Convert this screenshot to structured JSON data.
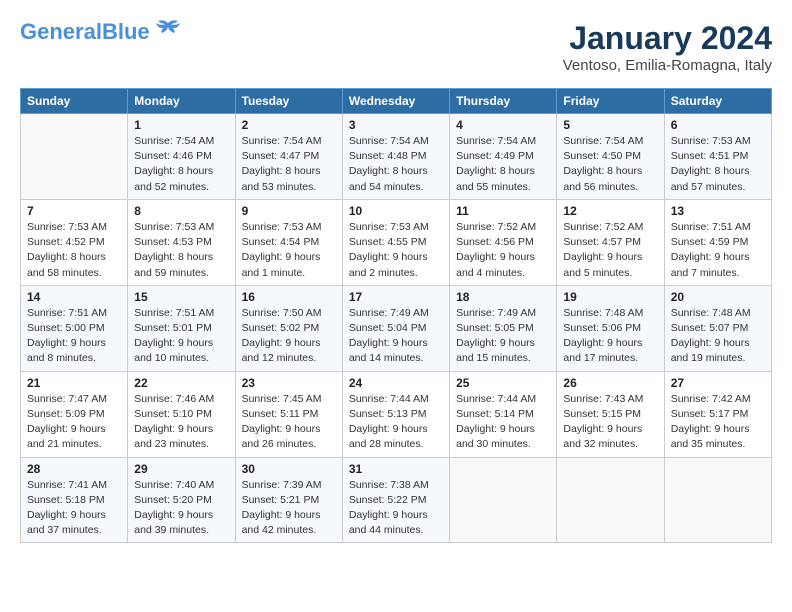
{
  "header": {
    "logo_line1": "General",
    "logo_line2": "Blue",
    "title": "January 2024",
    "subtitle": "Ventoso, Emilia-Romagna, Italy"
  },
  "weekdays": [
    "Sunday",
    "Monday",
    "Tuesday",
    "Wednesday",
    "Thursday",
    "Friday",
    "Saturday"
  ],
  "weeks": [
    [
      {
        "num": "",
        "detail": ""
      },
      {
        "num": "1",
        "detail": "Sunrise: 7:54 AM\nSunset: 4:46 PM\nDaylight: 8 hours\nand 52 minutes."
      },
      {
        "num": "2",
        "detail": "Sunrise: 7:54 AM\nSunset: 4:47 PM\nDaylight: 8 hours\nand 53 minutes."
      },
      {
        "num": "3",
        "detail": "Sunrise: 7:54 AM\nSunset: 4:48 PM\nDaylight: 8 hours\nand 54 minutes."
      },
      {
        "num": "4",
        "detail": "Sunrise: 7:54 AM\nSunset: 4:49 PM\nDaylight: 8 hours\nand 55 minutes."
      },
      {
        "num": "5",
        "detail": "Sunrise: 7:54 AM\nSunset: 4:50 PM\nDaylight: 8 hours\nand 56 minutes."
      },
      {
        "num": "6",
        "detail": "Sunrise: 7:53 AM\nSunset: 4:51 PM\nDaylight: 8 hours\nand 57 minutes."
      }
    ],
    [
      {
        "num": "7",
        "detail": "Sunrise: 7:53 AM\nSunset: 4:52 PM\nDaylight: 8 hours\nand 58 minutes."
      },
      {
        "num": "8",
        "detail": "Sunrise: 7:53 AM\nSunset: 4:53 PM\nDaylight: 8 hours\nand 59 minutes."
      },
      {
        "num": "9",
        "detail": "Sunrise: 7:53 AM\nSunset: 4:54 PM\nDaylight: 9 hours\nand 1 minute."
      },
      {
        "num": "10",
        "detail": "Sunrise: 7:53 AM\nSunset: 4:55 PM\nDaylight: 9 hours\nand 2 minutes."
      },
      {
        "num": "11",
        "detail": "Sunrise: 7:52 AM\nSunset: 4:56 PM\nDaylight: 9 hours\nand 4 minutes."
      },
      {
        "num": "12",
        "detail": "Sunrise: 7:52 AM\nSunset: 4:57 PM\nDaylight: 9 hours\nand 5 minutes."
      },
      {
        "num": "13",
        "detail": "Sunrise: 7:51 AM\nSunset: 4:59 PM\nDaylight: 9 hours\nand 7 minutes."
      }
    ],
    [
      {
        "num": "14",
        "detail": "Sunrise: 7:51 AM\nSunset: 5:00 PM\nDaylight: 9 hours\nand 8 minutes."
      },
      {
        "num": "15",
        "detail": "Sunrise: 7:51 AM\nSunset: 5:01 PM\nDaylight: 9 hours\nand 10 minutes."
      },
      {
        "num": "16",
        "detail": "Sunrise: 7:50 AM\nSunset: 5:02 PM\nDaylight: 9 hours\nand 12 minutes."
      },
      {
        "num": "17",
        "detail": "Sunrise: 7:49 AM\nSunset: 5:04 PM\nDaylight: 9 hours\nand 14 minutes."
      },
      {
        "num": "18",
        "detail": "Sunrise: 7:49 AM\nSunset: 5:05 PM\nDaylight: 9 hours\nand 15 minutes."
      },
      {
        "num": "19",
        "detail": "Sunrise: 7:48 AM\nSunset: 5:06 PM\nDaylight: 9 hours\nand 17 minutes."
      },
      {
        "num": "20",
        "detail": "Sunrise: 7:48 AM\nSunset: 5:07 PM\nDaylight: 9 hours\nand 19 minutes."
      }
    ],
    [
      {
        "num": "21",
        "detail": "Sunrise: 7:47 AM\nSunset: 5:09 PM\nDaylight: 9 hours\nand 21 minutes."
      },
      {
        "num": "22",
        "detail": "Sunrise: 7:46 AM\nSunset: 5:10 PM\nDaylight: 9 hours\nand 23 minutes."
      },
      {
        "num": "23",
        "detail": "Sunrise: 7:45 AM\nSunset: 5:11 PM\nDaylight: 9 hours\nand 26 minutes."
      },
      {
        "num": "24",
        "detail": "Sunrise: 7:44 AM\nSunset: 5:13 PM\nDaylight: 9 hours\nand 28 minutes."
      },
      {
        "num": "25",
        "detail": "Sunrise: 7:44 AM\nSunset: 5:14 PM\nDaylight: 9 hours\nand 30 minutes."
      },
      {
        "num": "26",
        "detail": "Sunrise: 7:43 AM\nSunset: 5:15 PM\nDaylight: 9 hours\nand 32 minutes."
      },
      {
        "num": "27",
        "detail": "Sunrise: 7:42 AM\nSunset: 5:17 PM\nDaylight: 9 hours\nand 35 minutes."
      }
    ],
    [
      {
        "num": "28",
        "detail": "Sunrise: 7:41 AM\nSunset: 5:18 PM\nDaylight: 9 hours\nand 37 minutes."
      },
      {
        "num": "29",
        "detail": "Sunrise: 7:40 AM\nSunset: 5:20 PM\nDaylight: 9 hours\nand 39 minutes."
      },
      {
        "num": "30",
        "detail": "Sunrise: 7:39 AM\nSunset: 5:21 PM\nDaylight: 9 hours\nand 42 minutes."
      },
      {
        "num": "31",
        "detail": "Sunrise: 7:38 AM\nSunset: 5:22 PM\nDaylight: 9 hours\nand 44 minutes."
      },
      {
        "num": "",
        "detail": ""
      },
      {
        "num": "",
        "detail": ""
      },
      {
        "num": "",
        "detail": ""
      }
    ]
  ]
}
